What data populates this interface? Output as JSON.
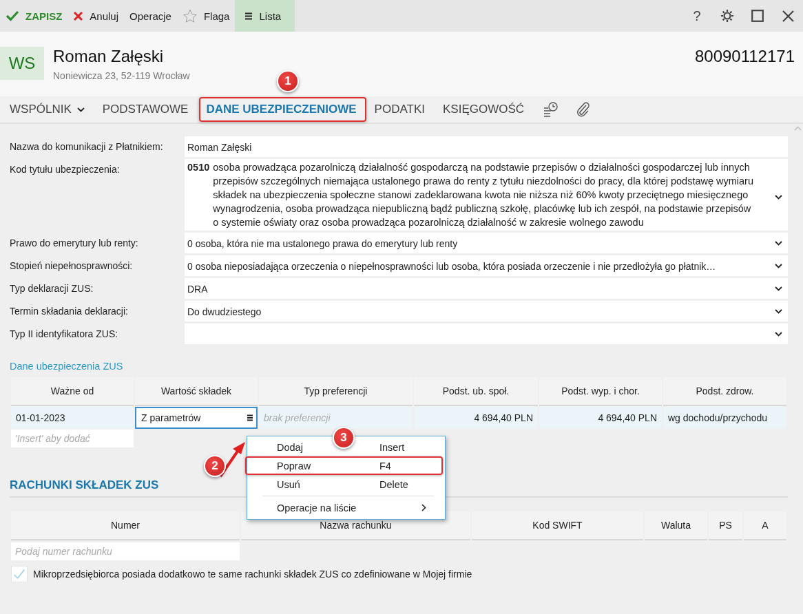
{
  "toolbar": {
    "items": [
      {
        "kind": "save",
        "label": "ZAPISZ",
        "selected": false
      },
      {
        "kind": "cancel",
        "label": "Anuluj",
        "selected": false
      },
      {
        "kind": "plain",
        "label": "Operacje",
        "selected": false
      },
      {
        "kind": "flag",
        "label": "Flaga",
        "selected": false
      },
      {
        "kind": "list",
        "label": "Lista",
        "selected": true
      }
    ],
    "help": "?"
  },
  "header": {
    "initials": "WS",
    "name": "Roman Załęski",
    "address": "Noniewicza 23, 52-119 Wrocław",
    "number": "80090112171"
  },
  "tabs": [
    {
      "label": "WSPÓLNIK",
      "kind": "dropdown",
      "selected": false,
      "marked": false
    },
    {
      "label": "PODSTAWOWE",
      "kind": "plain",
      "selected": false,
      "marked": false
    },
    {
      "label": "DANE UBEZPIECZENIOWE",
      "kind": "plain",
      "selected": true,
      "marked": true
    },
    {
      "label": "PODATKI",
      "kind": "plain",
      "selected": false,
      "marked": false
    },
    {
      "label": "KSIĘGOWOŚĆ",
      "kind": "plain",
      "selected": false,
      "marked": false
    }
  ],
  "form": {
    "fields": [
      {
        "kind": "text",
        "label": "Nazwa do komunikacji z Płatnikiem:",
        "value": "Roman Załęski"
      },
      {
        "kind": "code_select",
        "label": "Kod tytułu ubezpieczenia:",
        "code": "0510",
        "value": "osoba prowadząca pozarolniczą działalność gospodarczą na podstawie przepisów o działalności gospodarczej lub innych przepisów szczególnych niemająca ustalonego prawa do renty z tytułu niezdolności do pracy, dla której podstawę wymiaru składek na ubezpieczenia społeczne stanowi zadeklarowana kwota nie niższa niż 60% kwoty przeciętnego miesięcznego wynagrodzenia, osoba prowadząca niepubliczną bądź publiczną szkołę, placówkę lub ich zespół, na podstawie przepisów o systemie oświaty oraz osoba prowadząca pozarolniczą działalność w zakresie wolnego zawodu"
      },
      {
        "kind": "select",
        "label": "Prawo do emerytury lub renty:",
        "value": "0  osoba, która nie ma ustalonego prawa do emerytury lub renty"
      },
      {
        "kind": "select",
        "label": "Stopień niepełnosprawności:",
        "value": "0  osoba nieposiadająca orzeczenia o niepełnosprawności lub osoba, która posiada orzeczenie i nie przedłożyła go płatnik…"
      },
      {
        "kind": "select",
        "label": "Typ deklaracji ZUS:",
        "value": "DRA"
      },
      {
        "kind": "select",
        "label": "Termin składania deklaracji:",
        "value": "Do dwudziestego"
      },
      {
        "kind": "select",
        "label": "Typ II identyfikatora ZUS:"
      }
    ]
  },
  "insurance": {
    "link": "Dane ubezpieczenia ZUS",
    "columns": [
      "Ważne od",
      "Wartość składek",
      "Typ preferencji",
      "Podst. ub. społ.",
      "Podst. wyp. i chor.",
      "Podst. zdrow."
    ],
    "rows": [
      {
        "cells": [
          {
            "kind": "text",
            "text": "01-01-2023"
          },
          {
            "kind": "edit",
            "text": "Z parametrów"
          },
          {
            "kind": "hint",
            "text": "brak preferencji"
          },
          {
            "kind": "amount",
            "text": "4 694,40 PLN"
          },
          {
            "kind": "amount",
            "text": "4 694,40 PLN"
          },
          {
            "kind": "text",
            "text": "wg dochodu/przychodu"
          }
        ]
      }
    ],
    "add_hint": "'Insert' aby dodać"
  },
  "accounts": {
    "title": "RACHUNKI SKŁADEK ZUS",
    "columns": [
      "Numer",
      "Nazwa rachunku",
      "Kod SWIFT",
      "Waluta",
      "PS",
      "A"
    ],
    "placeholder": "Podaj numer rachunku",
    "checkbox": {
      "label": "Mikroprzedsiębiorca posiada dodatkowo te same rachunki składek ZUS co zdefiniowane w Mojej firmie",
      "checked": true
    }
  },
  "context_menu": {
    "items": [
      {
        "kind": "item",
        "label": "Dodaj",
        "shortcut": "Insert",
        "marked": false
      },
      {
        "kind": "item",
        "label": "Popraw",
        "shortcut": "F4",
        "marked": true
      },
      {
        "kind": "item",
        "label": "Usuń",
        "shortcut": "Delete",
        "marked": false
      },
      {
        "kind": "separator"
      },
      {
        "kind": "submenu",
        "label": "Operacje na liście",
        "marked": false
      }
    ]
  },
  "annotations": {
    "badges": [
      "1",
      "2",
      "3"
    ]
  }
}
